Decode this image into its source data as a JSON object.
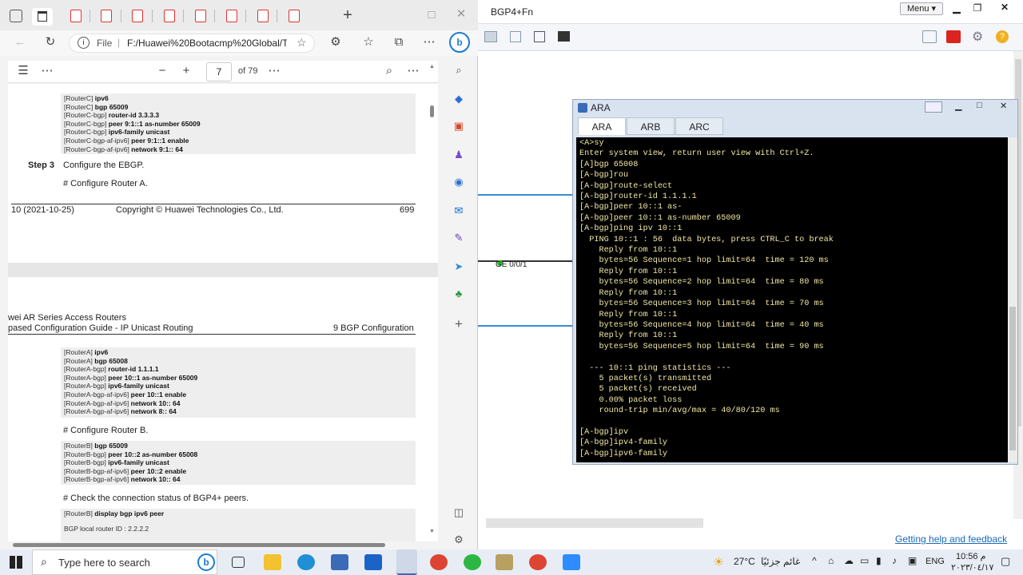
{
  "browser": {
    "url_label": "File",
    "url": "F:/Huawei%20Bootacmp%20Global/T...",
    "page_current": "7",
    "page_total": "of 79"
  },
  "pdf": {
    "block1": [
      {
        "p": "[RouterC] ",
        "c": "ipv6"
      },
      {
        "p": "[RouterC] ",
        "c": "bgp 65009"
      },
      {
        "p": "[RouterC-bgp] ",
        "c": "router-id 3.3.3.3"
      },
      {
        "p": "[RouterC-bgp] ",
        "c": "peer 9:1::1 as-number 65009"
      },
      {
        "p": "[RouterC-bgp] ",
        "c": "ipv6-family unicast"
      },
      {
        "p": "[RouterC-bgp-af-ipv6] ",
        "c": "peer 9:1::1 enable"
      },
      {
        "p": "[RouterC-bgp-af-ipv6] ",
        "c": "network 9:1:: 64"
      }
    ],
    "step_label": "Step 3",
    "step_text": "Configure the EBGP.",
    "configure_a": "# Configure Router A.",
    "footer_left": "10 (2021-10-25)",
    "footer_mid": "Copyright © Huawei Technologies Co., Ltd.",
    "footer_right": "699",
    "header1": "wei AR Series Access Routers",
    "header2": "pased Configuration Guide - IP Unicast Routing",
    "header2_right": "9 BGP Configuration",
    "block2": [
      {
        "p": "[RouterA] ",
        "c": "ipv6"
      },
      {
        "p": "[RouterA] ",
        "c": "bgp 65008"
      },
      {
        "p": "[RouterA-bgp] ",
        "c": "router-id 1.1.1.1"
      },
      {
        "p": "[RouterA-bgp] ",
        "c": "peer 10::1 as-number 65009"
      },
      {
        "p": "[RouterA-bgp] ",
        "c": "ipv6-family unicast"
      },
      {
        "p": "[RouterA-bgp-af-ipv6] ",
        "c": "peer 10::1 enable"
      },
      {
        "p": "[RouterA-bgp-af-ipv6] ",
        "c": "network 10:: 64"
      },
      {
        "p": "[RouterA-bgp-af-ipv6] ",
        "c": "network 8:: 64"
      }
    ],
    "configure_b": "# Configure Router B.",
    "block3": [
      {
        "p": "[RouterB] ",
        "c": "bgp 65009"
      },
      {
        "p": "[RouterB-bgp] ",
        "c": "peer 10::2 as-number 65008"
      },
      {
        "p": "[RouterB-bgp] ",
        "c": "ipv6-family unicast"
      },
      {
        "p": "[RouterB-bgp-af-ipv6] ",
        "c": "peer 10::2 enable"
      },
      {
        "p": "[RouterB-bgp-af-ipv6] ",
        "c": "network 10:: 64"
      }
    ],
    "check_text": "# Check the connection status of BGP4+ peers.",
    "block4_cmd_p": "[RouterB] ",
    "block4_cmd_c": "display bgp ipv6 peer",
    "block4_out": "BGP local router ID : 2.2.2.2"
  },
  "ensp": {
    "title": "BGP4+Fn",
    "menu": "Menu",
    "interface_label": "GE 0/0/1",
    "help_link": "Getting help and feedback"
  },
  "ara": {
    "title": "ARA",
    "tabs": [
      "ARA",
      "ARB",
      "ARC"
    ],
    "terminal": "<A>sy\nEnter system view, return user view with Ctrl+Z.\n[A]bgp 65008\n[A-bgp]rou\n[A-bgp]route-select\n[A-bgp]router-id 1.1.1.1\n[A-bgp]peer 10::1 as-\n[A-bgp]peer 10::1 as-number 65009\n[A-bgp]ping ipv 10::1\n  PING 10::1 : 56  data bytes, press CTRL_C to break\n    Reply from 10::1\n    bytes=56 Sequence=1 hop limit=64  time = 120 ms\n    Reply from 10::1\n    bytes=56 Sequence=2 hop limit=64  time = 80 ms\n    Reply from 10::1\n    bytes=56 Sequence=3 hop limit=64  time = 70 ms\n    Reply from 10::1\n    bytes=56 Sequence=4 hop limit=64  time = 40 ms\n    Reply from 10::1\n    bytes=56 Sequence=5 hop limit=64  time = 90 ms\n\n  --- 10::1 ping statistics ---\n    5 packet(s) transmitted\n    5 packet(s) received\n    0.00% packet loss\n    round-trip min/avg/max = 40/80/120 ms\n\n[A-bgp]ipv\n[A-bgp]ipv4-family\n[A-bgp]ipv6-family"
  },
  "taskbar": {
    "search_placeholder": "Type here to search",
    "weather": "27°C",
    "weather_text": "غائم جزئيًا",
    "lang": "ENG",
    "time": "10:56 م",
    "date": "٢٠٢٣/٠٤/١٧"
  }
}
